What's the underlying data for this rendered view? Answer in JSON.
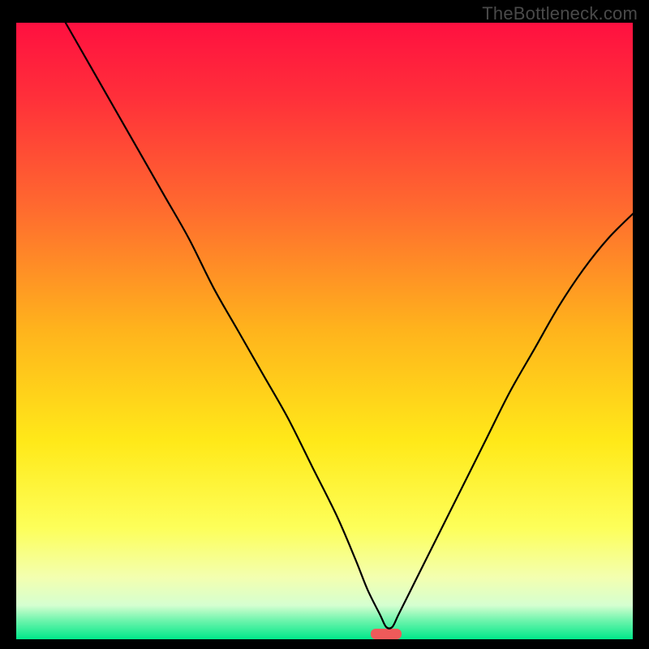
{
  "watermark": "TheBottleneck.com",
  "chart_data": {
    "type": "line",
    "title": "",
    "xlabel": "",
    "ylabel": "",
    "xlim": [
      0,
      100
    ],
    "ylim": [
      0,
      100
    ],
    "series": [
      {
        "name": "bottleneck-curve",
        "x": [
          8,
          12,
          16,
          20,
          24,
          28,
          32,
          36,
          40,
          44,
          48,
          52,
          55,
          57,
          59,
          60,
          61,
          62,
          64,
          68,
          72,
          76,
          80,
          84,
          88,
          92,
          96,
          100
        ],
        "y": [
          100,
          93,
          86,
          79,
          72,
          65,
          57,
          50,
          43,
          36,
          28,
          20,
          13,
          8,
          4,
          2,
          2,
          4,
          8,
          16,
          24,
          32,
          40,
          47,
          54,
          60,
          65,
          69
        ]
      }
    ],
    "marker": {
      "x": 60,
      "width": 5,
      "color": "#ef5a5a"
    },
    "background_gradient": {
      "stops": [
        {
          "offset": 0.0,
          "color": "#ff1040"
        },
        {
          "offset": 0.12,
          "color": "#ff2f3a"
        },
        {
          "offset": 0.3,
          "color": "#ff6a2f"
        },
        {
          "offset": 0.5,
          "color": "#ffb41c"
        },
        {
          "offset": 0.68,
          "color": "#ffe919"
        },
        {
          "offset": 0.82,
          "color": "#fdff5a"
        },
        {
          "offset": 0.9,
          "color": "#f3ffb0"
        },
        {
          "offset": 0.945,
          "color": "#d5ffd0"
        },
        {
          "offset": 0.97,
          "color": "#6cf4ac"
        },
        {
          "offset": 1.0,
          "color": "#00e88a"
        }
      ]
    }
  }
}
